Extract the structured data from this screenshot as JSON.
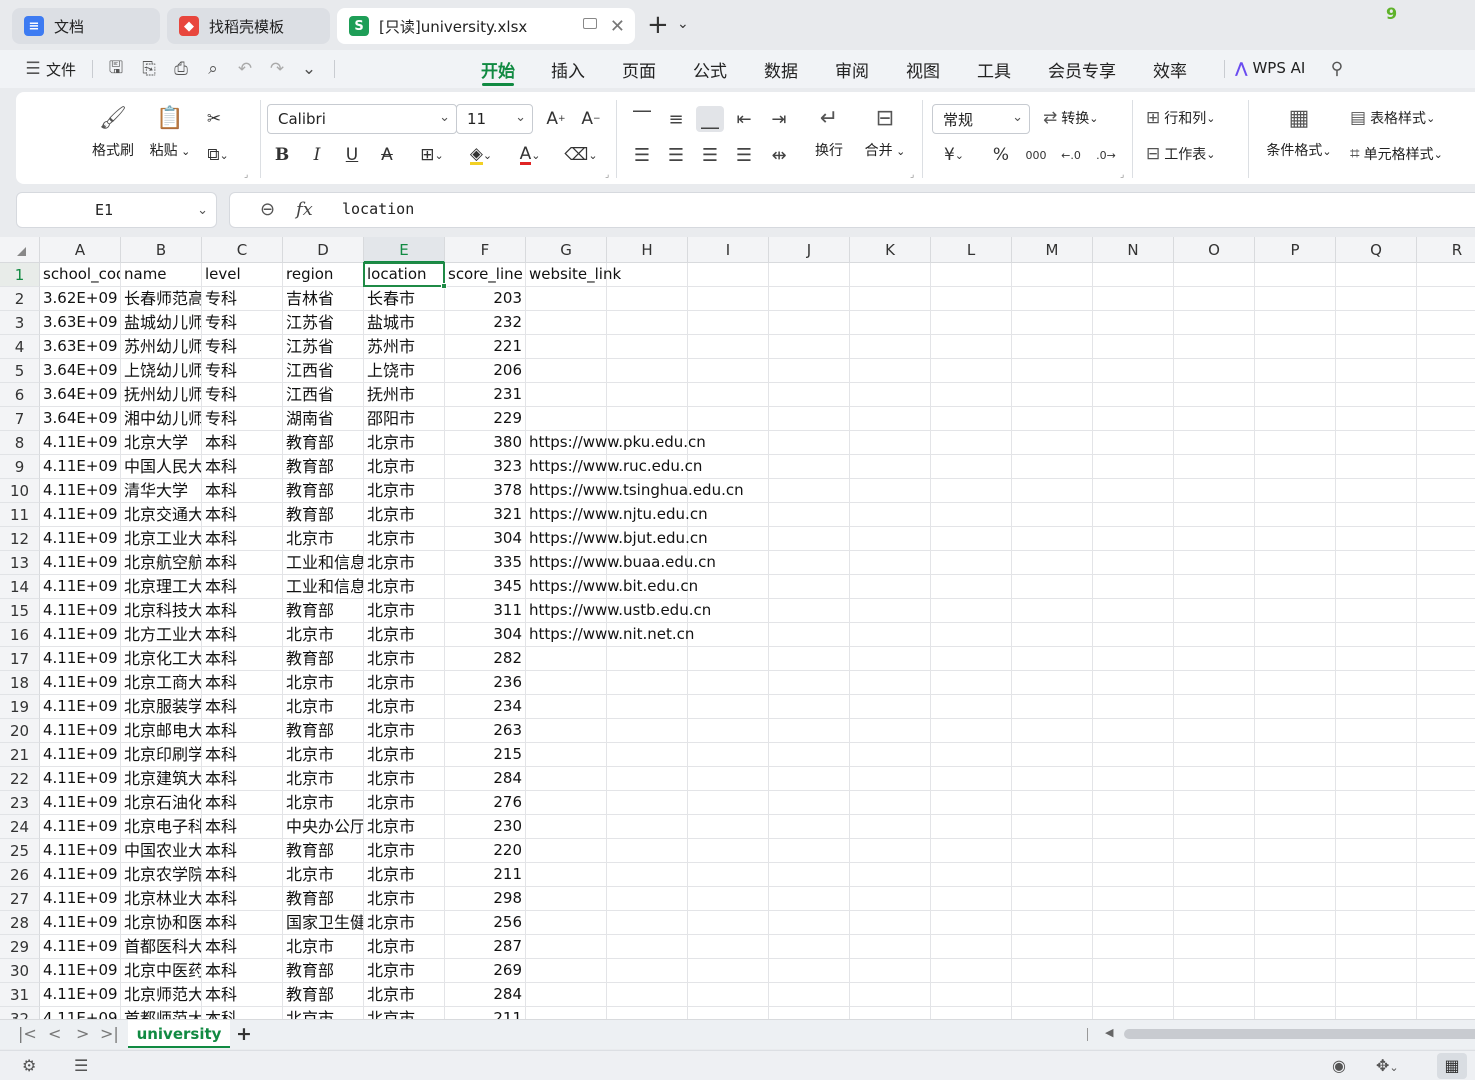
{
  "tabs": [
    {
      "title": "文档",
      "icon": "docs-icon",
      "color": "#3d7bf2",
      "glyph": "≡"
    },
    {
      "title": "找稻壳模板",
      "icon": "daoke-icon",
      "color": "#e8463d",
      "glyph": "◆"
    },
    {
      "title": "[只读]university.xlsx",
      "icon": "spreadsheet-icon",
      "color": "#1e9e57",
      "glyph": "S"
    }
  ],
  "notification_badge": "9",
  "menu": {
    "file_label": "文件",
    "tabs": [
      "开始",
      "插入",
      "页面",
      "公式",
      "数据",
      "审阅",
      "视图",
      "工具",
      "会员专享",
      "效率"
    ],
    "active_tab": "开始",
    "wps_ai_label": "WPS AI"
  },
  "ribbon": {
    "format_painter": "格式刷",
    "paste": "粘贴",
    "font_name": "Calibri",
    "font_size": "11",
    "wrap": "换行",
    "merge": "合并",
    "number_format": "常规",
    "convert": "转换",
    "rows_cols": "行和列",
    "worksheet": "工作表",
    "conditional_format": "条件格式",
    "table_style": "表格样式",
    "cell_style": "单元格样式",
    "currency_symbol": "¥",
    "percent_symbol": "%",
    "thousands_symbol": "000"
  },
  "formula_bar": {
    "cell_ref": "E1",
    "value": "location",
    "fx_label": "fx"
  },
  "columns": [
    "A",
    "B",
    "C",
    "D",
    "E",
    "F",
    "G",
    "H",
    "I",
    "J",
    "K",
    "L",
    "M",
    "N",
    "O",
    "P",
    "Q",
    "R"
  ],
  "selected_column": "E",
  "selected_row": "1",
  "header_row": [
    "school_code",
    "name",
    "level",
    "region",
    "location",
    "score_line",
    "website_link"
  ],
  "rows": [
    [
      "3.62E+09",
      "长春师范高等专科学校",
      "专科",
      "吉林省",
      "长春市",
      "203",
      ""
    ],
    [
      "3.63E+09",
      "盐城幼儿师范高等专科学校",
      "专科",
      "江苏省",
      "盐城市",
      "232",
      ""
    ],
    [
      "3.63E+09",
      "苏州幼儿师范高等专科学校",
      "专科",
      "江苏省",
      "苏州市",
      "221",
      ""
    ],
    [
      "3.64E+09",
      "上饶幼儿师范高等专科学校",
      "专科",
      "江西省",
      "上饶市",
      "206",
      ""
    ],
    [
      "3.64E+09",
      "抚州幼儿师范高等专科学校",
      "专科",
      "江西省",
      "抚州市",
      "231",
      ""
    ],
    [
      "3.64E+09",
      "湘中幼儿师范高等专科学校",
      "专科",
      "湖南省",
      "邵阳市",
      "229",
      ""
    ],
    [
      "4.11E+09",
      "北京大学",
      "本科",
      "教育部",
      "北京市",
      "380",
      "https://www.pku.edu.cn"
    ],
    [
      "4.11E+09",
      "中国人民大学",
      "本科",
      "教育部",
      "北京市",
      "323",
      "https://www.ruc.edu.cn"
    ],
    [
      "4.11E+09",
      "清华大学",
      "本科",
      "教育部",
      "北京市",
      "378",
      "https://www.tsinghua.edu.cn"
    ],
    [
      "4.11E+09",
      "北京交通大学",
      "本科",
      "教育部",
      "北京市",
      "321",
      "https://www.njtu.edu.cn"
    ],
    [
      "4.11E+09",
      "北京工业大学",
      "本科",
      "北京市",
      "北京市",
      "304",
      "https://www.bjut.edu.cn"
    ],
    [
      "4.11E+09",
      "北京航空航天大学",
      "本科",
      "工业和信息化部",
      "北京市",
      "335",
      "https://www.buaa.edu.cn"
    ],
    [
      "4.11E+09",
      "北京理工大学",
      "本科",
      "工业和信息化部",
      "北京市",
      "345",
      "https://www.bit.edu.cn"
    ],
    [
      "4.11E+09",
      "北京科技大学",
      "本科",
      "教育部",
      "北京市",
      "311",
      "https://www.ustb.edu.cn"
    ],
    [
      "4.11E+09",
      "北方工业大学",
      "本科",
      "北京市",
      "北京市",
      "304",
      "https://www.nit.net.cn"
    ],
    [
      "4.11E+09",
      "北京化工大学",
      "本科",
      "教育部",
      "北京市",
      "282",
      ""
    ],
    [
      "4.11E+09",
      "北京工商大学",
      "本科",
      "北京市",
      "北京市",
      "236",
      ""
    ],
    [
      "4.11E+09",
      "北京服装学院",
      "本科",
      "北京市",
      "北京市",
      "234",
      ""
    ],
    [
      "4.11E+09",
      "北京邮电大学",
      "本科",
      "教育部",
      "北京市",
      "263",
      ""
    ],
    [
      "4.11E+09",
      "北京印刷学院",
      "本科",
      "北京市",
      "北京市",
      "215",
      ""
    ],
    [
      "4.11E+09",
      "北京建筑大学",
      "本科",
      "北京市",
      "北京市",
      "284",
      ""
    ],
    [
      "4.11E+09",
      "北京石油化工学院",
      "本科",
      "北京市",
      "北京市",
      "276",
      ""
    ],
    [
      "4.11E+09",
      "北京电子科技学院",
      "本科",
      "中央办公厅",
      "北京市",
      "230",
      ""
    ],
    [
      "4.11E+09",
      "中国农业大学",
      "本科",
      "教育部",
      "北京市",
      "220",
      ""
    ],
    [
      "4.11E+09",
      "北京农学院",
      "本科",
      "北京市",
      "北京市",
      "211",
      ""
    ],
    [
      "4.11E+09",
      "北京林业大学",
      "本科",
      "教育部",
      "北京市",
      "298",
      ""
    ],
    [
      "4.11E+09",
      "北京协和医学院",
      "本科",
      "国家卫生健康委员会",
      "北京市",
      "256",
      ""
    ],
    [
      "4.11E+09",
      "首都医科大学",
      "本科",
      "北京市",
      "北京市",
      "287",
      ""
    ],
    [
      "4.11E+09",
      "北京中医药大学",
      "本科",
      "教育部",
      "北京市",
      "269",
      ""
    ],
    [
      "4.11E+09",
      "北京师范大学",
      "本科",
      "教育部",
      "北京市",
      "284",
      ""
    ],
    [
      "4.11E+09",
      "首都师范大学",
      "本科",
      "北京市",
      "北京市",
      "211",
      ""
    ]
  ],
  "sheet_tab": "university",
  "colors": {
    "accent": "#118a42",
    "selection": "#1f8a46"
  }
}
